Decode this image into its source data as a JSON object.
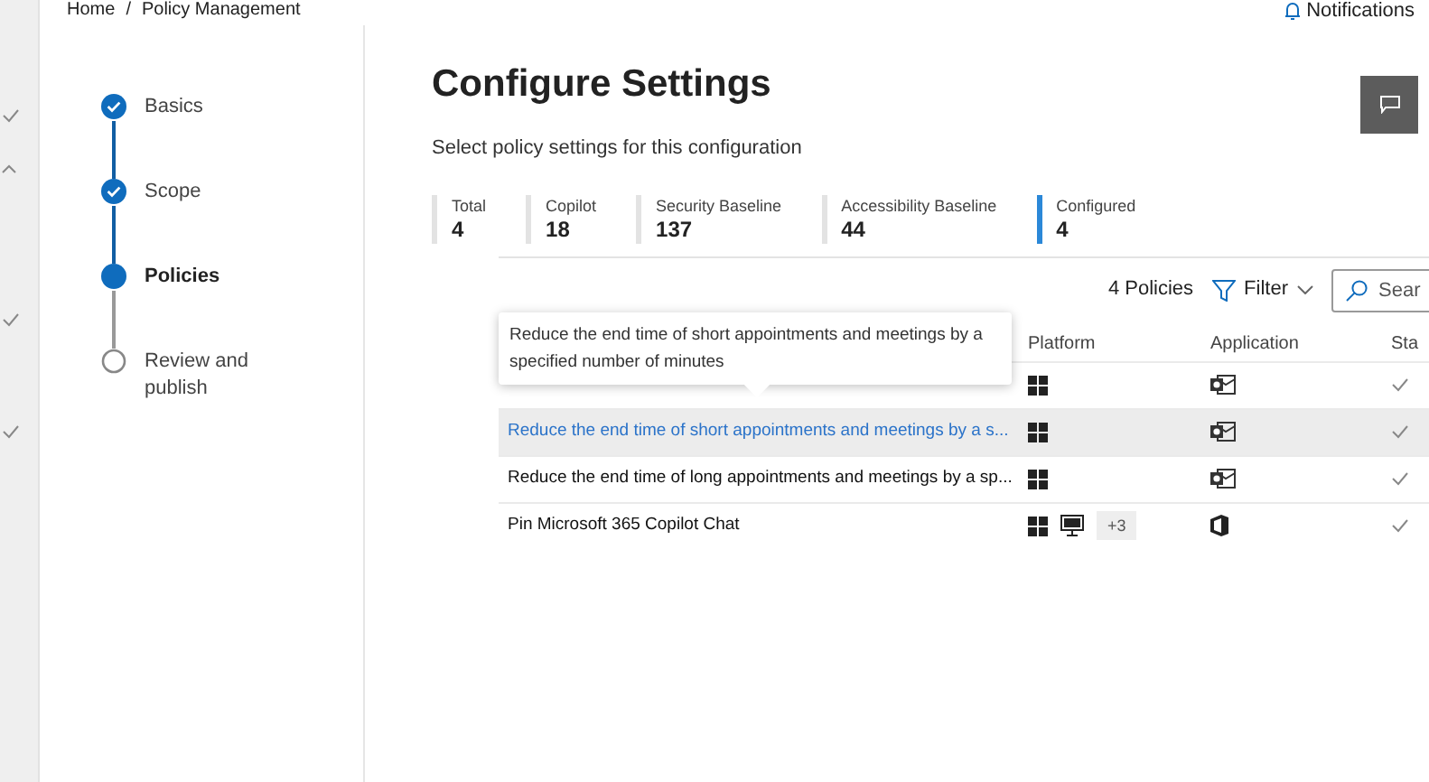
{
  "breadcrumb": [
    "Home",
    "Policy Management"
  ],
  "breadcrumb_separator": "/",
  "notifications": "Notifications",
  "steps": [
    {
      "label": "Basics",
      "done": true,
      "current": false
    },
    {
      "label": "Scope",
      "done": true,
      "current": false
    },
    {
      "label": "Policies",
      "done": false,
      "current": true
    },
    {
      "label": "Review and publish",
      "done": false,
      "current": false
    }
  ],
  "title": "Configure Settings",
  "subtitle": "Select policy settings for this configuration",
  "stats": [
    {
      "label": "Total",
      "value": "4",
      "selected": false
    },
    {
      "label": "Copilot",
      "value": "18",
      "selected": false
    },
    {
      "label": "Security Baseline",
      "value": "137",
      "selected": false
    },
    {
      "label": "Accessibility Baseline",
      "value": "44",
      "selected": false
    },
    {
      "label": "Configured",
      "value": "4",
      "selected": true
    }
  ],
  "toolbar": {
    "count": "4 Policies",
    "filter": "Filter",
    "search_placeholder": "Sear"
  },
  "table": {
    "columns": [
      "Platform",
      "Application",
      "Sta"
    ],
    "rows": [
      {
        "kind": "mail",
        "selected": false
      },
      {
        "kind": "mail",
        "name": "Reduce the end time of short appointments and meetings by a s...",
        "selected": true
      },
      {
        "kind": "mail",
        "name": "Reduce the end time of long appointments and meetings by a sp...",
        "selected": false
      },
      {
        "kind": "office",
        "name": "Pin Microsoft 365 Copilot Chat",
        "more": "+3",
        "selected": false
      }
    ]
  },
  "tooltip": "Reduce the end time of short appointments and meetings by a specified number of minutes"
}
